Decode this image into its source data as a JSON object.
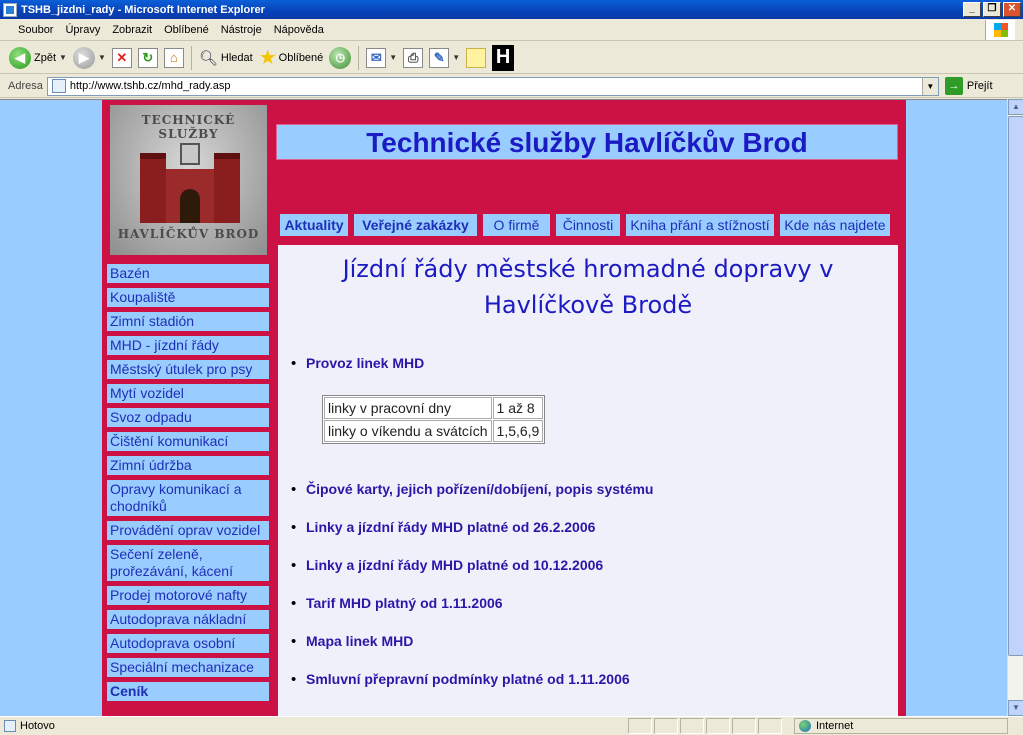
{
  "window": {
    "title": "TSHB_jizdni_rady - Microsoft Internet Explorer",
    "minimize": "_",
    "restore": "❐",
    "close": "✕"
  },
  "menu": [
    "Soubor",
    "Úpravy",
    "Zobrazit",
    "Oblíbené",
    "Nástroje",
    "Nápověda"
  ],
  "toolbar": {
    "back": "Zpět",
    "search": "Hledat",
    "favorites": "Oblíbené"
  },
  "address": {
    "label": "Adresa",
    "url": "http://www.tshb.cz/mhd_rady.asp",
    "go": "Přejít"
  },
  "site": {
    "logo_top": "TECHNICKÉ SLUŽBY",
    "logo_bottom": "HAVLÍČKŮV BROD",
    "header": "Technické služby Havlíčkův Brod",
    "tabs": [
      {
        "label": "Aktuality"
      },
      {
        "label": "Veřejné zakázky"
      },
      {
        "label": "O firmě"
      },
      {
        "label": "Činnosti"
      },
      {
        "label": "Kniha přání a stížností"
      },
      {
        "label": "Kde nás najdete"
      }
    ],
    "sidenav": [
      {
        "label": "Bazén"
      },
      {
        "label": "Koupaliště"
      },
      {
        "label": "Zimní stadión"
      },
      {
        "label": "MHD - jízdní řády"
      },
      {
        "label": "Městský útulek pro psy"
      },
      {
        "label": "Mytí vozidel"
      },
      {
        "label": "Svoz odpadu"
      },
      {
        "label": "Čištění komunikací"
      },
      {
        "label": "Zimní údržba"
      },
      {
        "label": "Opravy komunikací a chodníků"
      },
      {
        "label": "Provádění oprav vozidel"
      },
      {
        "label": "Sečení zeleně, prořezávání, kácení"
      },
      {
        "label": "Prodej motorové nafty"
      },
      {
        "label": "Autodoprava nákladní"
      },
      {
        "label": "Autodoprava osobní"
      },
      {
        "label": "Speciální mechanizace"
      },
      {
        "label": "Ceník"
      }
    ],
    "page_title_line1": "Jízdní řády městské hromadné dopravy v",
    "page_title_line2": "Havlíčkově Brodě",
    "operation_heading": "Provoz linek MHD",
    "schedule": [
      {
        "label": "linky v pracovní dny",
        "value": "1 až 8"
      },
      {
        "label": "linky o víkendu a svátcích",
        "value": "1,5,6,9"
      }
    ],
    "links": [
      "Čipové karty, jejich pořízení/dobíjení, popis systému",
      "Linky a jízdní řády MHD platné od 26.2.2006",
      "Linky a jízdní řády MHD platné od 10.12.2006",
      "Tarif MHD platný od 1.11.2006",
      "Mapa linek MHD",
      "Smluvní přepravní podmínky platné od 1.11.2006"
    ]
  },
  "status": {
    "text": "Hotovo",
    "zone": "Internet"
  }
}
